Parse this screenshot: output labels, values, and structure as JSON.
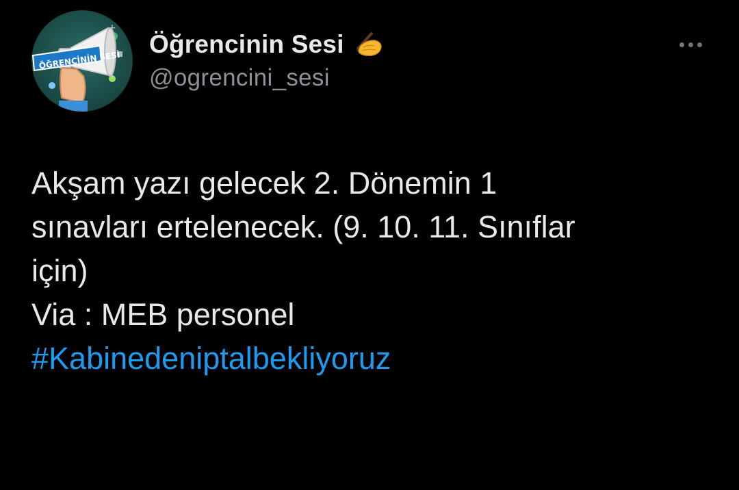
{
  "author": {
    "display_name": "Öğrencinin Sesi",
    "name_emoji": "writing-hand-emoji",
    "handle": "@ogrencini_sesi",
    "avatar_text": "ÖĞRENCİNİN SESİ"
  },
  "menu": {
    "icon": "more-dots-icon"
  },
  "tweet": {
    "lines": [
      "Akşam yazı gelecek 2. Dönemin 1",
      "sınavları ertelenecek. (9. 10. 11. Sınıflar",
      "için)",
      "Via : MEB personel"
    ],
    "hashtag": "#Kabinedeniptalbekliyoruz"
  },
  "colors": {
    "background": "#000000",
    "text": "#e7e9ea",
    "secondary_text": "#8b9197",
    "link": "#1d9bf0"
  }
}
